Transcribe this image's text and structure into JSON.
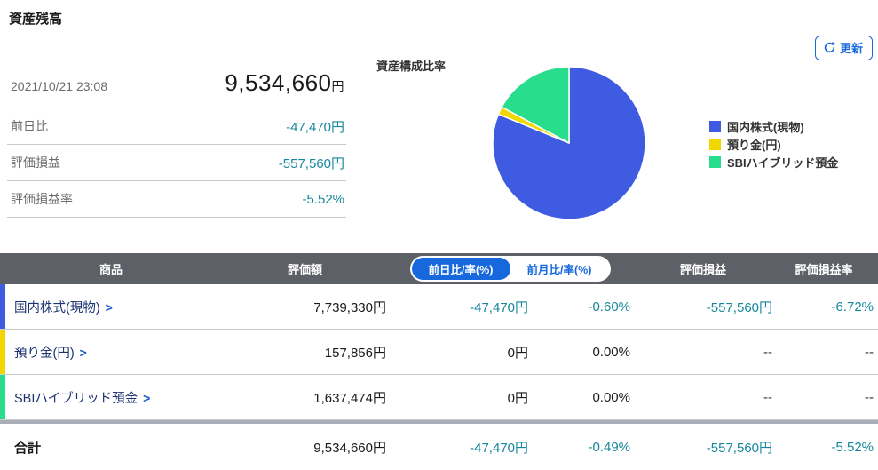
{
  "page": {
    "title": "資産残高"
  },
  "refresh": {
    "label": "更新"
  },
  "summary": {
    "timestamp": "2021/10/21 23:08",
    "total_value": "9,534,660",
    "currency_suffix": "円",
    "rows": [
      {
        "label": "前日比",
        "value": "-47,470円"
      },
      {
        "label": "評価損益",
        "value": "-557,560円"
      },
      {
        "label": "評価損益率",
        "value": "-5.52%"
      }
    ]
  },
  "chart_data": {
    "type": "pie",
    "title": "資産構成比率",
    "labels": [
      "国内株式(現物)",
      "預り金(円)",
      "SBIハイブリッド預金"
    ],
    "values": [
      7739330,
      157856,
      1637474
    ],
    "percentages": [
      81.17,
      1.66,
      17.17
    ],
    "colors": [
      "#3e5be1",
      "#f2d600",
      "#28de8d"
    ],
    "start_angle_deg": 0,
    "direction": "clockwise",
    "slice_border_color": "#ffffff",
    "legend_position": "right"
  },
  "table": {
    "headers": {
      "product": "商品",
      "value": "評価額",
      "pl": "評価損益",
      "pl_rate": "評価損益率"
    },
    "toggle": {
      "day": "前日比/率(%)",
      "month": "前月比/率(%)",
      "selected": "前日比/率(%)"
    },
    "rows": [
      {
        "name": "国内株式(現物)",
        "chevron": ">",
        "value": "7,739,330円",
        "day_change": "-47,470円",
        "day_rate": "-0.60%",
        "pl": "-557,560円",
        "pl_rate": "-6.72%"
      },
      {
        "name": "預り金(円)",
        "chevron": ">",
        "value": "157,856円",
        "day_change": "0円",
        "day_rate": "0.00%",
        "pl": "--",
        "pl_rate": "--"
      },
      {
        "name": "SBIハイブリッド預金",
        "chevron": ">",
        "value": "1,637,474円",
        "day_change": "0円",
        "day_rate": "0.00%",
        "pl": "--",
        "pl_rate": "--"
      }
    ],
    "total": {
      "name": "合計",
      "value": "9,534,660円",
      "day_change": "-47,470円",
      "day_rate": "-0.49%",
      "pl": "-557,560円",
      "pl_rate": "-5.52%"
    }
  },
  "colors": {
    "accent_blue": "#1668dc",
    "negative_teal": "#17879c",
    "header_bg": "#5d6066",
    "link_navy": "#1d3271"
  }
}
